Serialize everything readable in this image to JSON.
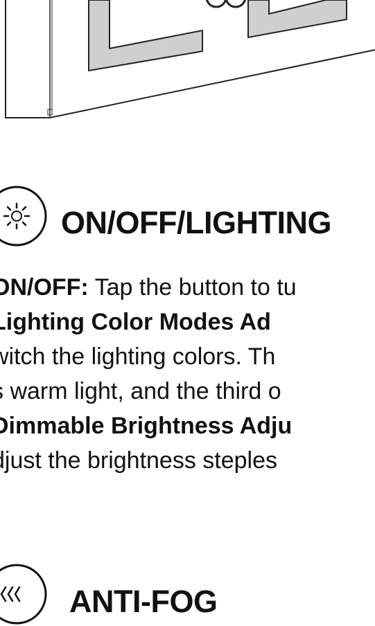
{
  "sections": {
    "lighting": {
      "icon": "sun-icon",
      "title": "ON/OFF/LIGHTING",
      "lines": [
        {
          "bold": "ON/OFF:",
          "text": " Tap the button to tu"
        },
        {
          "bold": " Lighting Color Modes Ad",
          "text": ""
        },
        {
          "bold": "",
          "text": "witch the lighting colors. Th"
        },
        {
          "bold": "",
          "text": "s warm light, and the third o"
        },
        {
          "bold": "Dimmable Brightness Adju",
          "text": ""
        },
        {
          "bold": "",
          "text": "djust the brightness steples"
        }
      ]
    },
    "antifog": {
      "icon": "defog-wave-icon",
      "title": "ANTI-FOG"
    }
  },
  "colors": {
    "text": "#111111",
    "frame_fill": "#cfcfcf",
    "outline": "#222222"
  }
}
